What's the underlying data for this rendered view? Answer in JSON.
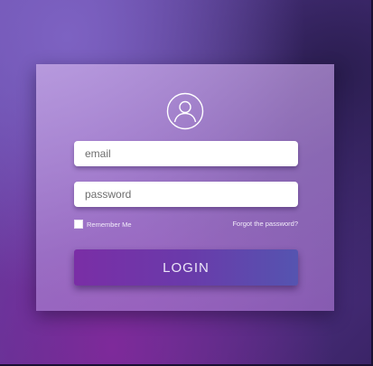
{
  "login_form": {
    "email": {
      "value": "",
      "placeholder": "email"
    },
    "password": {
      "value": "",
      "placeholder": "password"
    },
    "remember_me": {
      "label": "Remember Me",
      "checked": false
    },
    "forgot_password_label": "Forgot the password?",
    "login_label": "LOGIN",
    "avatar_icon": "user-icon"
  },
  "colors": {
    "button_start": "#7a2ea6",
    "button_end": "#5554b0",
    "card": "#b48fd6",
    "background": "#5a3a98"
  }
}
